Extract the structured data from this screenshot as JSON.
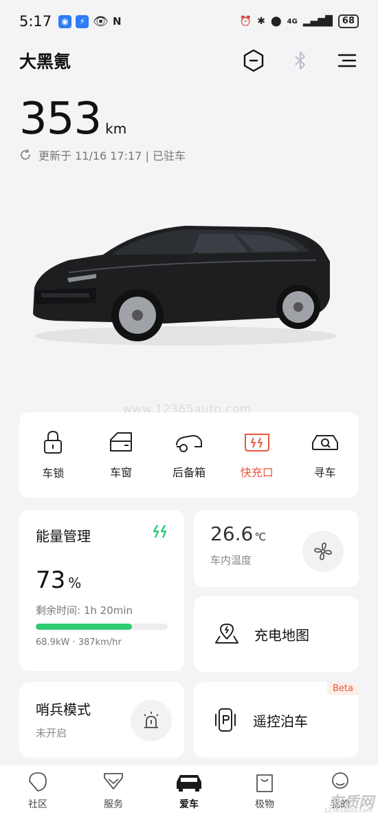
{
  "status_bar": {
    "time": "5:17",
    "network": "4G",
    "battery": "68"
  },
  "header": {
    "car_name": "大黑氪"
  },
  "range": {
    "value": "353",
    "unit": "km",
    "updated": "更新于 11/16 17:17 | 已驻车"
  },
  "watermark": "www.12365auto.com",
  "quick_actions": [
    {
      "label": "车锁",
      "icon": "lock-icon",
      "active": false
    },
    {
      "label": "车窗",
      "icon": "window-icon",
      "active": false
    },
    {
      "label": "后备箱",
      "icon": "trunk-icon",
      "active": false
    },
    {
      "label": "快充口",
      "icon": "fast-charge-port-icon",
      "active": true
    },
    {
      "label": "寻车",
      "icon": "find-car-icon",
      "active": false
    }
  ],
  "energy": {
    "title": "能量管理",
    "percent": "73",
    "percent_unit": "%",
    "remaining_label": "剩余时间:",
    "remaining_value": "1h 20min",
    "charge_fraction": 0.73,
    "power_info": "68.9kW · 387km/hr",
    "accent": "#2ecc71"
  },
  "climate": {
    "temperature": "26.6",
    "temp_unit": "℃",
    "label": "车内温度"
  },
  "charging_map": {
    "label": "充电地图"
  },
  "sentry": {
    "title": "哨兵模式",
    "status": "未开启"
  },
  "remote_parking": {
    "label": "遥控泊车",
    "badge": "Beta"
  },
  "bottom_nav": [
    {
      "label": "社区",
      "icon": "community-icon",
      "active": false
    },
    {
      "label": "服务",
      "icon": "service-icon",
      "active": false
    },
    {
      "label": "爱车",
      "icon": "car-icon",
      "active": true
    },
    {
      "label": "极物",
      "icon": "shop-bag-icon",
      "active": false
    },
    {
      "label": "我的",
      "icon": "profile-icon",
      "active": false
    }
  ],
  "corner_logo": {
    "text": "车质网",
    "sub": "12365auto.com"
  },
  "colors": {
    "accent_orange": "#e8573a",
    "energy_green": "#2ecc71",
    "background": "#f4f4f6"
  }
}
